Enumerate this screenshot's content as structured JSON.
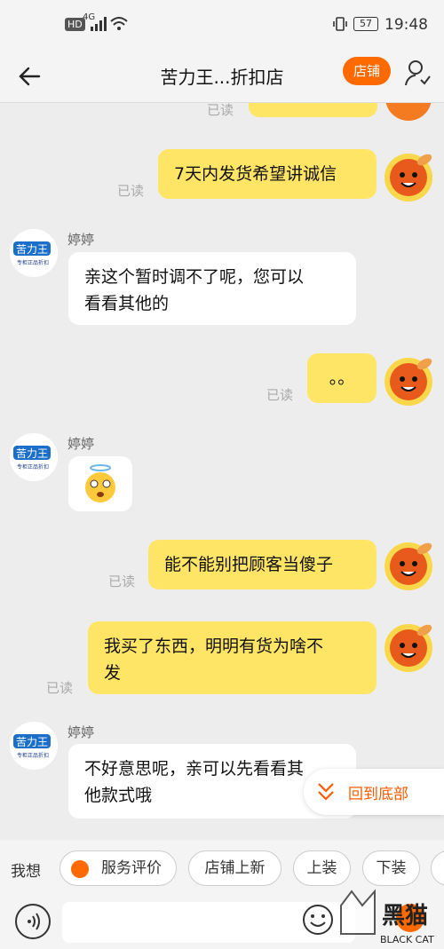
{
  "status_bar": {
    "hd": "HD",
    "signal": "4G",
    "battery": "57",
    "time": "19:48"
  },
  "header": {
    "title": "苦力王...折扣店",
    "shop_button": "店铺"
  },
  "messages": [
    {
      "side": "right",
      "text": "",
      "read": "已读"
    },
    {
      "side": "right",
      "text": "7天内发货希望讲诚信",
      "read": "已读"
    },
    {
      "side": "left",
      "name": "婷婷",
      "text_line1": "亲这个暂时调不了呢，您可以",
      "text_line2": "看看其他的"
    },
    {
      "side": "right",
      "text": "。。",
      "read": "已读"
    },
    {
      "side": "left",
      "name": "婷婷",
      "emoji": "dizzy-face-emoji"
    },
    {
      "side": "right",
      "text": "能不能别把顾客当傻子",
      "read": "已读"
    },
    {
      "side": "right",
      "text_line1": "我买了东西，明明有货为啥不",
      "text_line2": "发",
      "read": "已读"
    },
    {
      "side": "left",
      "name": "婷婷",
      "text_line1": "不好意思呢，亲可以先看看其",
      "text_line2": "他款式哦"
    }
  ],
  "shop_avatar_text": {
    "line1": "苦力王",
    "line2": "专柜正品折扣"
  },
  "back_to_bottom": "回到底部",
  "quick_replies": {
    "prefix": "我想",
    "items": [
      "服务评价",
      "店铺上新",
      "上装",
      "下装"
    ]
  },
  "input": {
    "placeholder": ""
  },
  "watermark": {
    "brand": "黑猫",
    "sub": "BLACK CAT"
  },
  "colors": {
    "accent": "#ff6a00",
    "bubble_me": "#ffe566",
    "bubble_them": "#ffffff",
    "background": "#ededed"
  }
}
